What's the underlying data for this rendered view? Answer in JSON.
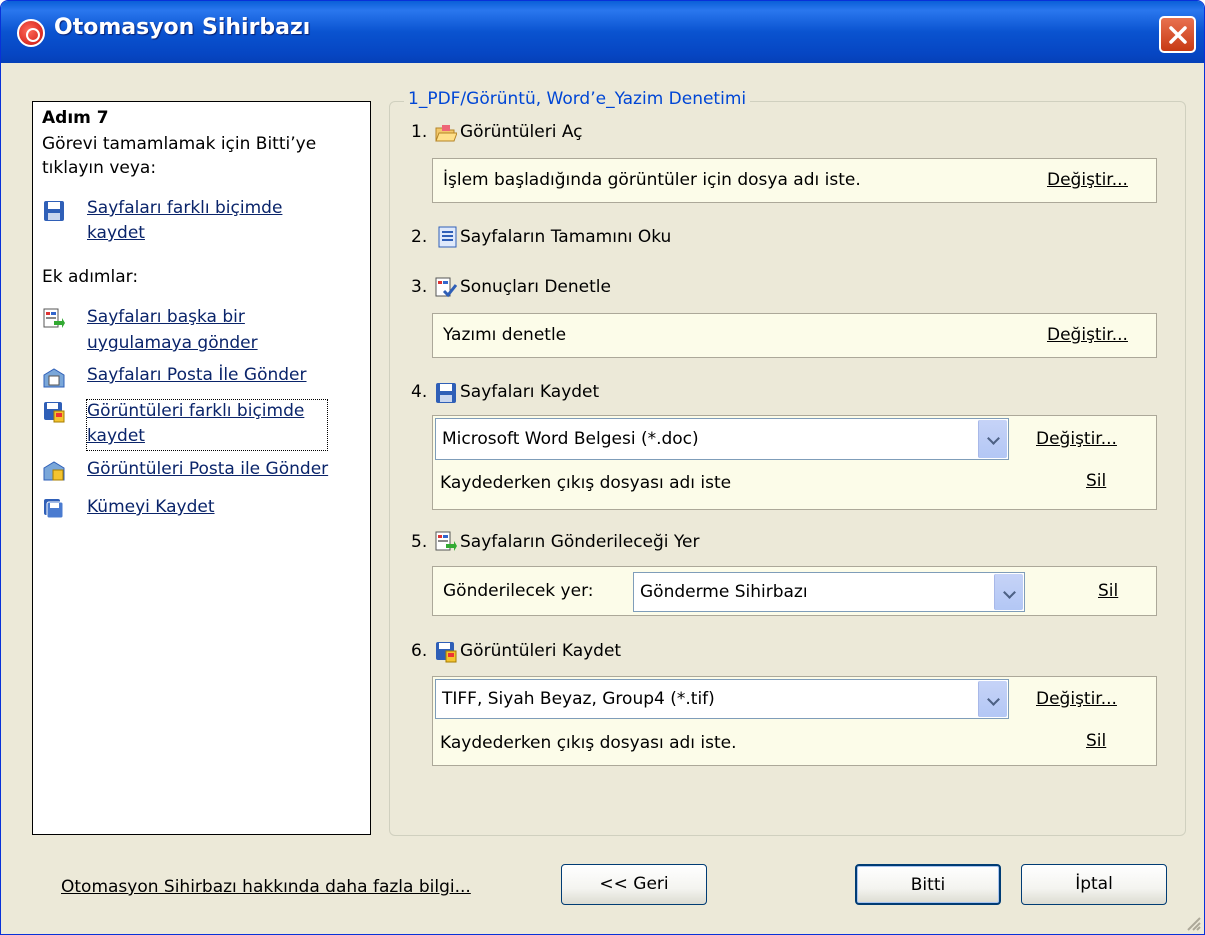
{
  "window": {
    "title": "Otomasyon Sihirbazı"
  },
  "sidebar": {
    "step_heading": "Adım 7",
    "instruction_line1": "Görevi tamamlamak için Bitti’ye",
    "instruction_line2": "tıklayın veya:",
    "save_pages_line1": "Sayfaları farklı biçimde",
    "save_pages_line2": "kaydet",
    "extra_heading": "Ek adımlar:",
    "send_app_line1": "Sayfaları başka bir",
    "send_app_line2": "uygulamaya gönder",
    "mail_pages": "Sayfaları Posta İle Gönder",
    "save_images_line1": "Görüntüleri farklı biçimde",
    "save_images_line2": "kaydet",
    "mail_images": "Görüntüleri Posta ile Gönder",
    "save_cluster": "Kümeyi Kaydet"
  },
  "main": {
    "group_title": "1_PDF/Görüntü, Word’e_Yazim Denetimi",
    "step1": {
      "num": "1.",
      "label": "Görüntüleri Aç",
      "detail": "İşlem başladığında görüntüler için dosya adı iste.",
      "link": "Değiştir..."
    },
    "step2": {
      "num": "2.",
      "label": "Sayfaların Tamamını Oku"
    },
    "step3": {
      "num": "3.",
      "label": "Sonuçları Denetle",
      "detail": "Yazımı denetle",
      "link": "Değiştir..."
    },
    "step4": {
      "num": "4.",
      "label": "Sayfaları Kaydet",
      "format": "Microsoft Word Belgesi (*.doc)",
      "link": "Değiştir...",
      "detail": "Kaydederken çıkış dosyası adı iste",
      "delete": "Sil"
    },
    "step5": {
      "num": "5.",
      "label": "Sayfaların Gönderileceği Yer",
      "target_label": "Gönderilecek yer:",
      "target": "Gönderme Sihirbazı",
      "delete": "Sil"
    },
    "step6": {
      "num": "6.",
      "label": "Görüntüleri Kaydet",
      "format": "TIFF, Siyah Beyaz, Group4 (*.tif)",
      "link": "Değiştir...",
      "detail": "Kaydederken çıkış dosyası adı iste.",
      "delete": "Sil"
    }
  },
  "footer": {
    "more_info": "Otomasyon Sihirbazı hakkında daha fazla bilgi...",
    "back": "<< Geri",
    "finish": "Bitti",
    "cancel": "İptal"
  },
  "icons": [
    "app-icon",
    "close-icon",
    "floppy-icon",
    "send-app-icon",
    "mail-icon",
    "save-image-icon",
    "mail-image-icon",
    "save-cluster-icon",
    "open-folder-icon",
    "read-page-icon",
    "check-icon",
    "chevron-down-icon"
  ]
}
